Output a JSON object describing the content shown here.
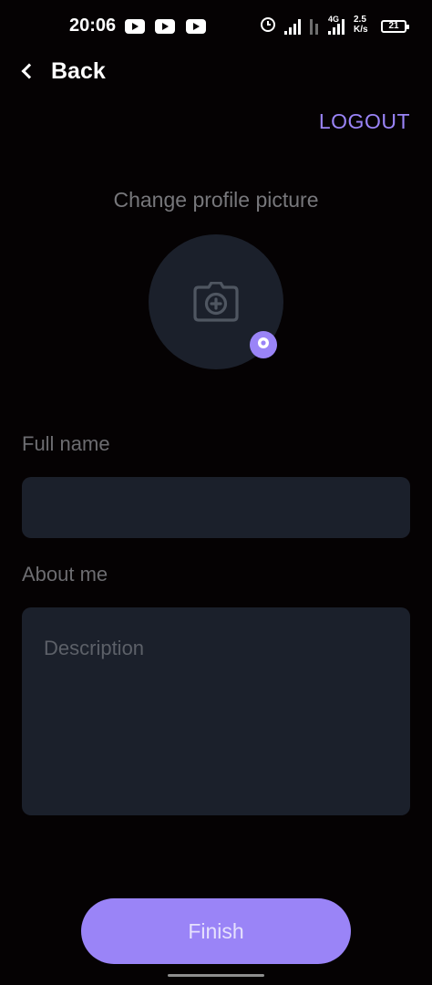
{
  "status_bar": {
    "time": "20:06",
    "network_type": "4G",
    "speed_value": "2.5",
    "speed_unit": "K/s",
    "battery": "21",
    "icons": [
      "youtube-icon",
      "youtube-icon",
      "youtube-icon",
      "alarm-icon",
      "signal-icon",
      "signal-icon",
      "battery-icon"
    ]
  },
  "nav": {
    "back_label": "Back",
    "logout_label": "LOGOUT"
  },
  "profile": {
    "change_picture_label": "Change profile picture",
    "camera_icon": "camera-icon",
    "edit_badge_icon": "camera-small-icon"
  },
  "form": {
    "full_name": {
      "label": "Full name",
      "value": "",
      "placeholder": ""
    },
    "about_me": {
      "label": "About me",
      "value": "",
      "placeholder": "Description"
    }
  },
  "finish_label": "Finish",
  "colors": {
    "background": "#050203",
    "accent": "#9a84f7",
    "field_background": "#1b202b",
    "label_text": "#6c6c70"
  }
}
